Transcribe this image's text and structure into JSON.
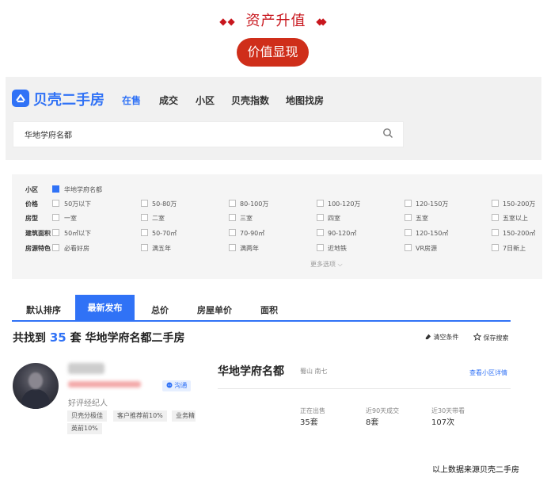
{
  "hero": {
    "title": "资产升值",
    "diamond": "◆",
    "pill": "价值显现"
  },
  "brand": {
    "name": "贝壳二手房",
    "accent": "#3072f6",
    "red": "#cf2e1a"
  },
  "nav": [
    "在售",
    "成交",
    "小区",
    "贝壳指数",
    "地图找房"
  ],
  "search": {
    "value": "华地学府名都",
    "icon": "search-icon"
  },
  "filters": {
    "rows": [
      {
        "label": "小区",
        "options": [
          "华地学府名都"
        ]
      },
      {
        "label": "价格",
        "options": [
          "50万以下",
          "50-80万",
          "80-100万",
          "100-120万",
          "120-150万",
          "150-200万"
        ]
      },
      {
        "label": "房型",
        "options": [
          "一室",
          "二室",
          "三室",
          "四室",
          "五室",
          "五室以上"
        ]
      },
      {
        "label": "建筑面积",
        "options": [
          "50㎡以下",
          "50-70㎡",
          "70-90㎡",
          "90-120㎡",
          "120-150㎡",
          "150-200㎡"
        ]
      },
      {
        "label": "房源特色",
        "options": [
          "必看好房",
          "满五年",
          "满两年",
          "近地铁",
          "VR房源",
          "7日新上"
        ]
      }
    ],
    "more": "更多选项 ⌵"
  },
  "tabs": [
    "默认排序",
    "最新发布",
    "总价",
    "房屋单价",
    "面积"
  ],
  "result": {
    "prefix": "共找到",
    "count": "35",
    "suffix": "套 华地学府名都二手房",
    "clear": "清空条件",
    "save": "保存搜索"
  },
  "agent": {
    "chat": "沟通",
    "title": "好评经纪人",
    "badges": [
      "贝壳分极佳",
      "客户推荐前10%",
      "业务精",
      "英前10%"
    ]
  },
  "community": {
    "name": "华地学府名都",
    "area": "蜀山 南七",
    "link": "查看小区详情",
    "stats": [
      {
        "label": "正在出售",
        "value": "35套"
      },
      {
        "label": "近90天成交",
        "value": "8套"
      },
      {
        "label": "近30天带看",
        "value": "107次"
      }
    ]
  },
  "source": "以上数据来源贝壳二手房"
}
